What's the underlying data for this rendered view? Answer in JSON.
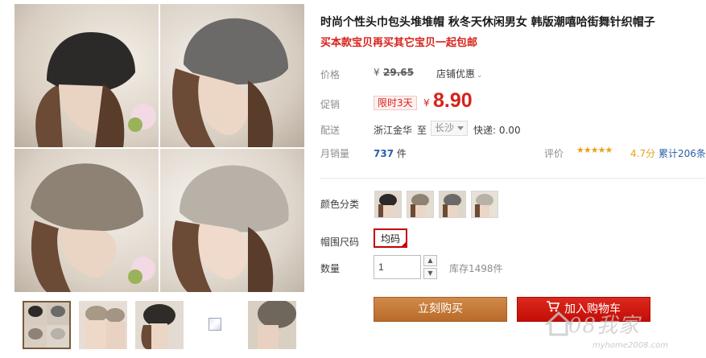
{
  "product": {
    "title": "时尚个性头巾包头堆堆帽 秋冬天休闲男女 韩版潮嘻哈街舞针织帽子",
    "subtitle": "买本款宝贝再买其它宝贝一起包邮"
  },
  "pricing": {
    "price_label": "价格",
    "currency": "¥",
    "original_price": "29.65",
    "shop_discount": "店铺优惠",
    "promo_label": "促销",
    "promo_badge": "限时3天",
    "sale_price": "8.90"
  },
  "shipping": {
    "label": "配送",
    "from": "浙江金华",
    "to_label": "至",
    "destination": "长沙",
    "fee": "快递: 0.00"
  },
  "sales": {
    "label": "月销量",
    "count": "737",
    "unit": "件",
    "rating_label": "评价",
    "stars": "★★★★★",
    "score": "4.7分",
    "reviews": "累计206条"
  },
  "options": {
    "color_label": "颜色分类",
    "size_label": "帽围尺码",
    "size_value": "均码",
    "qty_label": "数量",
    "qty_value": "1",
    "stock": "库存1498件"
  },
  "actions": {
    "buy_now": "立刻购买",
    "add_to_cart": "加入购物车"
  },
  "watermark": {
    "logo_text": "08我家",
    "url": "myhome2008.com"
  },
  "colors": {
    "accent_red": "#d7221a",
    "buy_orange": "#c97a3b",
    "cart_red": "#c40d05",
    "link_blue": "#2a5fa8"
  }
}
